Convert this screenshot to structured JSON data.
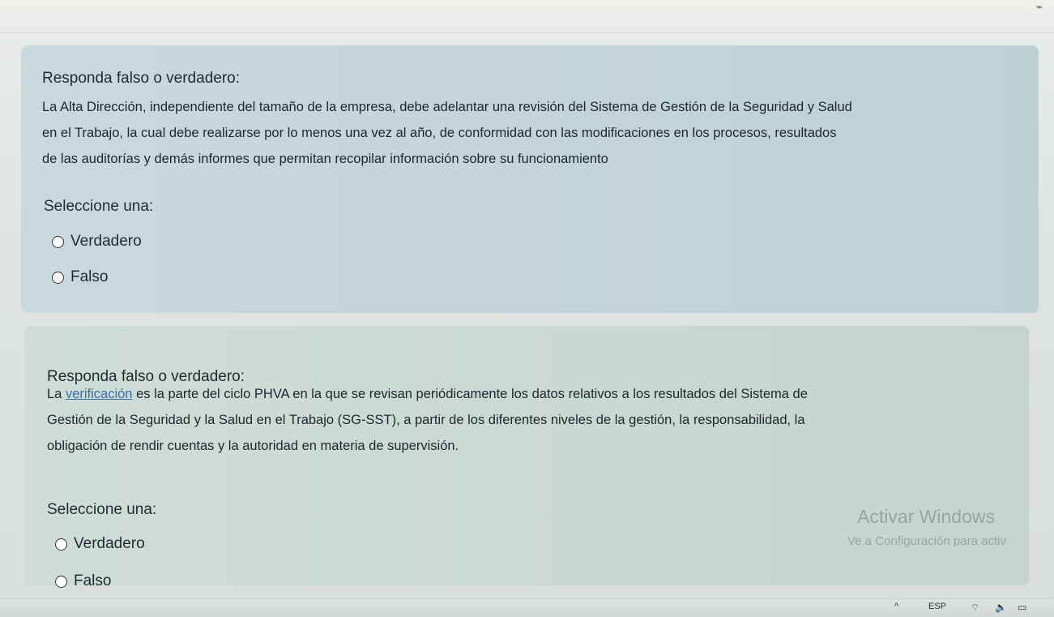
{
  "system": {
    "language": "ESP",
    "up_chevron_glyph": "^",
    "wifi_glyph": "⌔",
    "volume_glyph": "🔈",
    "battery_glyph": "▭"
  },
  "questions": [
    {
      "title": "Responda falso o verdadero:",
      "text_line_1": "La Alta Dirección, independiente del tamaño de la empresa, debe adelantar una revisión del Sistema de Gestión de la Seguridad y Salud",
      "text_line_2": "en el Trabajo, la cual debe realizarse por lo menos una vez al año, de conformidad con las modificaciones en los procesos, resultados",
      "text_line_3": "de las auditorías y demás informes que permitan recopilar información sobre su funcionamiento",
      "select_label": "Seleccione una:",
      "options": [
        {
          "label": "Verdadero"
        },
        {
          "label": "Falso"
        }
      ]
    },
    {
      "title": "Responda falso o verdadero:",
      "text_prefix": "La ",
      "text_link": "verificación",
      "text_line_1_rest": " es la parte del ciclo PHVA en la que se revisan periódicamente los datos relativos a los resultados del Sistema de",
      "text_line_2": "Gestión de la Seguridad y la Salud en el Trabajo (SG-SST), a partir de los diferentes niveles de la gestión, la responsabilidad, la",
      "text_line_3": "obligación de rendir cuentas y la autoridad en materia de supervisión.",
      "select_label": "Seleccione una:",
      "options": [
        {
          "label": "Verdadero"
        },
        {
          "label": "Falso"
        }
      ]
    }
  ],
  "watermark": {
    "line_1": "Activar Windows",
    "line_2": "Ve a Configuración para activ"
  },
  "colors": {
    "link": "#3a6ea8",
    "card_1_bg": "#c3d5da",
    "card_2_bg": "#cad8d3"
  }
}
